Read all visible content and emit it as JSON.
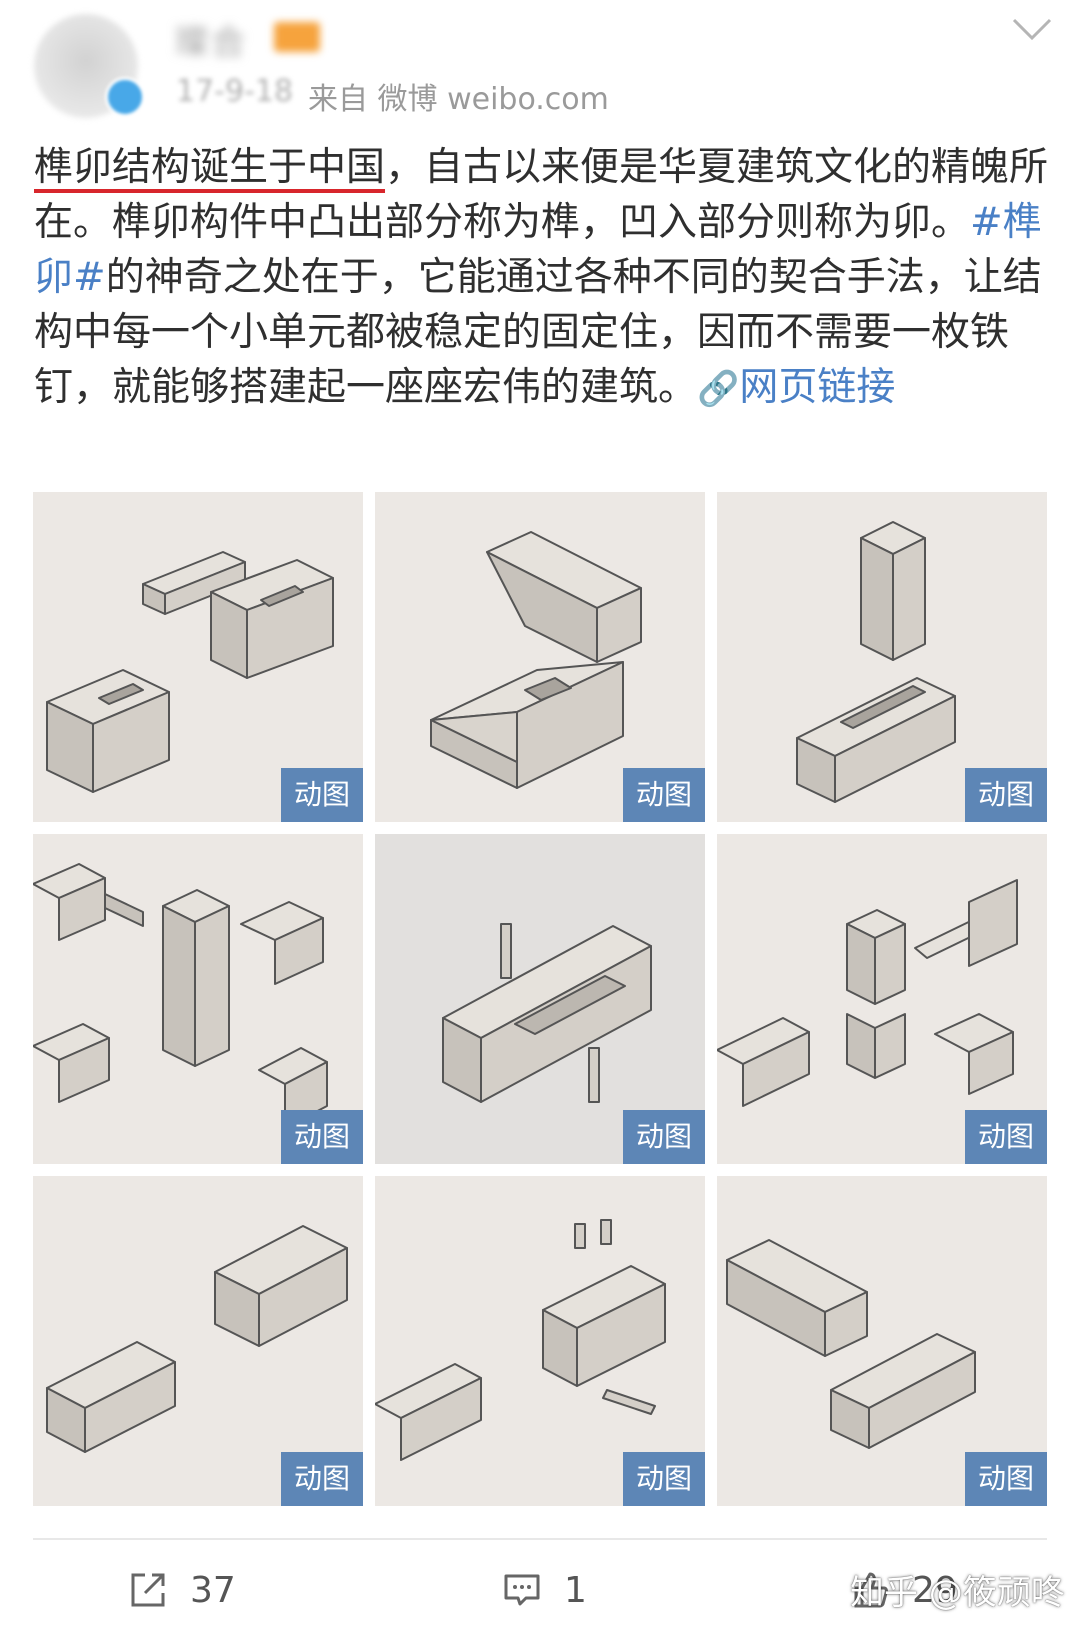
{
  "post": {
    "author_name": "璨合",
    "date": "17-9-18",
    "source": "来自 微博 weibo.com",
    "text_underlined": "榫卯结构诞生于中国",
    "text_part1": "，自古以来便是华夏建筑文化的精魄所在。榫卯构件中凸出部分称为榫，凹入部分则称为卯。",
    "topic": "#榫卯#",
    "text_part2": "的神奇之处在于，它能通过各种不同的契合手法，让结构中每一个小单元都被稳定的固定住，因而不需要一枚铁钉，就能够搭建起一座座宏伟的建筑。",
    "link_icon": "link-icon",
    "link_text": "网页链接"
  },
  "images": [
    {
      "badge": "动图"
    },
    {
      "badge": "动图"
    },
    {
      "badge": "动图"
    },
    {
      "badge": "动图"
    },
    {
      "badge": "动图"
    },
    {
      "badge": "动图"
    },
    {
      "badge": "动图"
    },
    {
      "badge": "动图"
    },
    {
      "badge": "动图"
    }
  ],
  "actions": {
    "repost_count": "37",
    "comment_count": "1",
    "like_count": "29"
  },
  "watermark": "知乎 @筱顽咚",
  "colors": {
    "link": "#4a80c6",
    "underline": "#d8262c",
    "gif_badge": "#5d86b6",
    "tile_background": "#ece8e4"
  }
}
